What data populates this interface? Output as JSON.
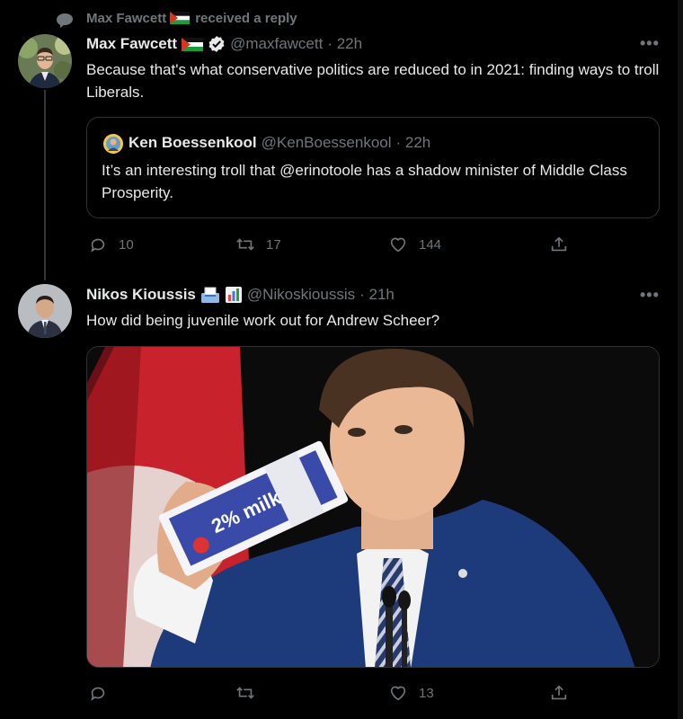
{
  "context": {
    "name": "Max Fawcett",
    "suffix": "received a reply"
  },
  "tweet1": {
    "name": "Max Fawcett",
    "handle": "@maxfawcett",
    "time": "· 22h",
    "text": "Because that's what conservative politics are reduced to in 2021: finding ways to troll Liberals.",
    "quote": {
      "name": "Ken Boessenkool",
      "handle": "@KenBoessenkool",
      "time": "· 22h",
      "text": "It’s an interesting troll that @erinotoole has a shadow minister of Middle Class Prosperity."
    },
    "actions": {
      "replies": "10",
      "retweets": "17",
      "likes": "144"
    }
  },
  "tweet2": {
    "name": "Nikos Kioussis",
    "handle": "@Nikoskioussis",
    "time": "· 21h",
    "text": "How did being juvenile work out for Andrew Scheer?",
    "carton_label": "2% milk",
    "actions": {
      "replies": "",
      "retweets": "",
      "likes": "13"
    }
  },
  "icons": {
    "reply": "reply-icon",
    "retweet": "retweet-icon",
    "like": "heart-icon",
    "share": "share-icon",
    "verified": "verified-badge-icon",
    "more": "more-icon"
  },
  "colors": {
    "background": "#000000",
    "text": "#e7e9ea",
    "muted": "#71767b",
    "border": "#2f3336"
  }
}
